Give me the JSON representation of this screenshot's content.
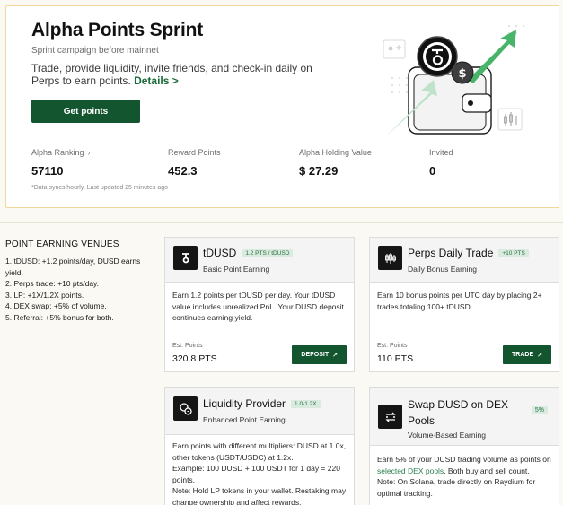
{
  "hero": {
    "title": "Alpha Points Sprint",
    "subtitle": "Sprint campaign before mainnet",
    "description": "Trade, provide liquidity, invite friends, and check-in daily on Perps to earn points.",
    "details_link": "Details >",
    "cta_label": "Get points",
    "sync_note": "*Data syncs hourly. Last updated 25 minutes ago"
  },
  "stats": [
    {
      "label": "Alpha Ranking",
      "value": "57110",
      "has_chevron": true
    },
    {
      "label": "Reward Points",
      "value": "452.3"
    },
    {
      "label": "Alpha Holding Value",
      "value": "$ 27.29"
    },
    {
      "label": "Invited",
      "value": "0"
    }
  ],
  "venues": {
    "heading": "POINT EARNING VENUES",
    "items": [
      "1. tDUSD: +1.2 points/day, DUSD earns yield.",
      "2. Perps trade: +10 pts/day.",
      "3. LP: +1X/1.2X points.",
      "4. DEX swap: +5% of volume.",
      "5. Referral: +5% bonus for both."
    ]
  },
  "cards": {
    "tdusd": {
      "icon": "tdusd-logo-icon",
      "name": "tDUSD",
      "badge": "1.2 PTS / tDUSD",
      "sub": "Basic Point Earning",
      "body": "Earn 1.2 points per tDUSD per day. Your tDUSD value includes unrealized PnL. Your DUSD deposit continues earning yield.",
      "est_label": "Est. Points",
      "est_value": "320.8 PTS",
      "action": "DEPOSIT"
    },
    "perps": {
      "icon": "candlestick-icon",
      "name": "Perps Daily Trade",
      "badge": "+10 PTS",
      "sub": "Daily Bonus Earning",
      "body": "Earn 10 bonus points per UTC day by placing 2+ trades totaling 100+ tDUSD.",
      "est_label": "Est. Points",
      "est_value": "110 PTS",
      "action": "TRADE"
    },
    "lp": {
      "icon": "liquidity-coins-icon",
      "name": "Liquidity Provider",
      "badge": "1.0-1.2X",
      "sub": "Enhanced Point Earning",
      "body_lines": [
        "Earn points with different multipliers: DUSD at 1.0x, other tokens (USDT/USDC) at 1.2x.",
        "Example: 100 DUSD + 100 USDT for 1 day = 220 points.",
        "Note: Hold LP tokens in your wallet. Restaking may change ownership and affect rewards."
      ]
    },
    "swap": {
      "icon": "swap-arrows-icon",
      "name_line1": "Swap DUSD on DEX",
      "name_line2": "Pools",
      "badge": "5%",
      "sub": "Volume-Based Earning",
      "body_pre": "Earn 5% of your DUSD trading volume as points on ",
      "body_link": "selected DEX pools",
      "body_post": ". Both buy and sell count.",
      "body_note": "Note: On Solana, trade directly on Raydium for optimal tracking."
    }
  },
  "colors": {
    "brand_green": "#13552f",
    "badge_bg": "#d9ebdf",
    "hero_border": "#f1d79c"
  }
}
